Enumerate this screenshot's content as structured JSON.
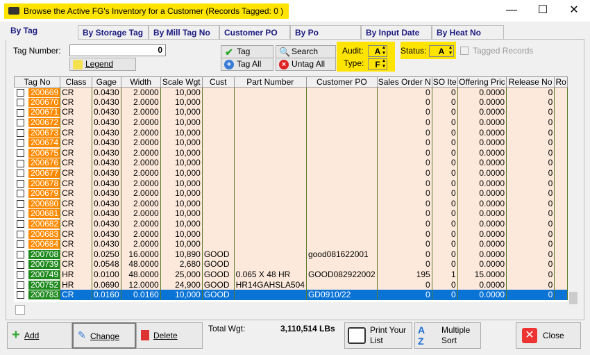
{
  "window": {
    "title": "Browse the Active FG's Inventory for a Customer  (Records Tagged:  0 )",
    "minimize": "—",
    "maximize": "☐",
    "close": "✕"
  },
  "tabs": [
    "By Tag",
    "By Storage Tag",
    "By Mill Tag No",
    "Customer PO",
    "By Po",
    "By Input Date",
    "By Heat No"
  ],
  "filters": {
    "tag_number_label": "Tag Number:",
    "tag_number_value": "0",
    "legend": "Legend",
    "tag": "Tag",
    "tag_all": "Tag All",
    "search": "Search",
    "untag_all": "Untag All",
    "audit_label": "Audit:",
    "audit_value": "A",
    "type_label": "Type:",
    "type_value": "F",
    "status_label": "Status:",
    "status_value": "A",
    "tagged_records": "Tagged Records"
  },
  "columns": [
    "Tag No",
    "Class",
    "Gage",
    "Width",
    "Scale Wgt",
    "Cust",
    "Part Number",
    "Customer PO",
    "Sales Order N",
    "SO Ite",
    "Offering Pric",
    "Release No",
    "Ro"
  ],
  "rows": [
    [
      "200669",
      "CR",
      "0.0430",
      "2.0000",
      "10,000",
      "",
      "",
      "",
      "0",
      "0",
      "0.0000",
      "0",
      "o"
    ],
    [
      "200670",
      "CR",
      "0.0430",
      "2.0000",
      "10,000",
      "",
      "",
      "",
      "0",
      "0",
      "0.0000",
      "0",
      "o"
    ],
    [
      "200671",
      "CR",
      "0.0430",
      "2.0000",
      "10,000",
      "",
      "",
      "",
      "0",
      "0",
      "0.0000",
      "0",
      "o"
    ],
    [
      "200672",
      "CR",
      "0.0430",
      "2.0000",
      "10,000",
      "",
      "",
      "",
      "0",
      "0",
      "0.0000",
      "0",
      "o"
    ],
    [
      "200673",
      "CR",
      "0.0430",
      "2.0000",
      "10,000",
      "",
      "",
      "",
      "0",
      "0",
      "0.0000",
      "0",
      "o"
    ],
    [
      "200674",
      "CR",
      "0.0430",
      "2.0000",
      "10,000",
      "",
      "",
      "",
      "0",
      "0",
      "0.0000",
      "0",
      "o"
    ],
    [
      "200675",
      "CR",
      "0.0430",
      "2.0000",
      "10,000",
      "",
      "",
      "",
      "0",
      "0",
      "0.0000",
      "0",
      "o"
    ],
    [
      "200676",
      "CR",
      "0.0430",
      "2.0000",
      "10,000",
      "",
      "",
      "",
      "0",
      "0",
      "0.0000",
      "0",
      "o"
    ],
    [
      "200677",
      "CR",
      "0.0430",
      "2.0000",
      "10,000",
      "",
      "",
      "",
      "0",
      "0",
      "0.0000",
      "0",
      "o"
    ],
    [
      "200678",
      "CR",
      "0.0430",
      "2.0000",
      "10,000",
      "",
      "",
      "",
      "0",
      "0",
      "0.0000",
      "0",
      "o"
    ],
    [
      "200679",
      "CR",
      "0.0430",
      "2.0000",
      "10,000",
      "",
      "",
      "",
      "0",
      "0",
      "0.0000",
      "0",
      "o"
    ],
    [
      "200680",
      "CR",
      "0.0430",
      "2.0000",
      "10,000",
      "",
      "",
      "",
      "0",
      "0",
      "0.0000",
      "0",
      "o"
    ],
    [
      "200681",
      "CR",
      "0.0430",
      "2.0000",
      "10,000",
      "",
      "",
      "",
      "0",
      "0",
      "0.0000",
      "0",
      "o"
    ],
    [
      "200682",
      "CR",
      "0.0430",
      "2.0000",
      "10,000",
      "",
      "",
      "",
      "0",
      "0",
      "0.0000",
      "0",
      "o"
    ],
    [
      "200683",
      "CR",
      "0.0430",
      "2.0000",
      "10,000",
      "",
      "",
      "",
      "0",
      "0",
      "0.0000",
      "0",
      "o"
    ],
    [
      "200684",
      "CR",
      "0.0430",
      "2.0000",
      "10,000",
      "",
      "",
      "",
      "0",
      "0",
      "0.0000",
      "0",
      "o"
    ],
    [
      "200708",
      "CR",
      "0.0250",
      "16.0000",
      "10,890",
      "GOOD",
      "",
      "good081622001",
      "0",
      "0",
      "0.0000",
      "0",
      "g"
    ],
    [
      "200739",
      "CR",
      "0.0548",
      "48.0000",
      "2,680",
      "GOOD",
      "",
      "",
      "0",
      "0",
      "0.0000",
      "0",
      "g"
    ],
    [
      "200749",
      "HR",
      "0.0100",
      "48.0000",
      "25,000",
      "GOOD",
      "0.065 X 48 HR",
      "GOOD082922002",
      "195",
      "1",
      "15.0000",
      "0",
      "g"
    ],
    [
      "200752",
      "HR",
      "0.0690",
      "12.0000",
      "24,900",
      "GOOD",
      "HR14GAHSLA504",
      "",
      "0",
      "0",
      "0.0000",
      "0",
      "g"
    ],
    [
      "200783",
      "CR",
      "0.0160",
      "0.0160",
      "10,000",
      "GOOD",
      "",
      "GD0910/22",
      "0",
      "0",
      "0.0000",
      "0",
      "s"
    ]
  ],
  "footer": {
    "add": "Add",
    "change": "Change",
    "delete": "Delete",
    "total_wgt_label": "Total Wgt:",
    "total_wgt_value": "3,110,514 LBs",
    "print": "Print Your List",
    "multiple_sort": "Multiple Sort",
    "close": "Close"
  },
  "colors": {
    "highlight": "#ffe400",
    "tag_orange": "#ff8a00",
    "tag_green": "#1e8a1e",
    "selected": "#0a73d6",
    "row_bg": "#fde9db"
  }
}
